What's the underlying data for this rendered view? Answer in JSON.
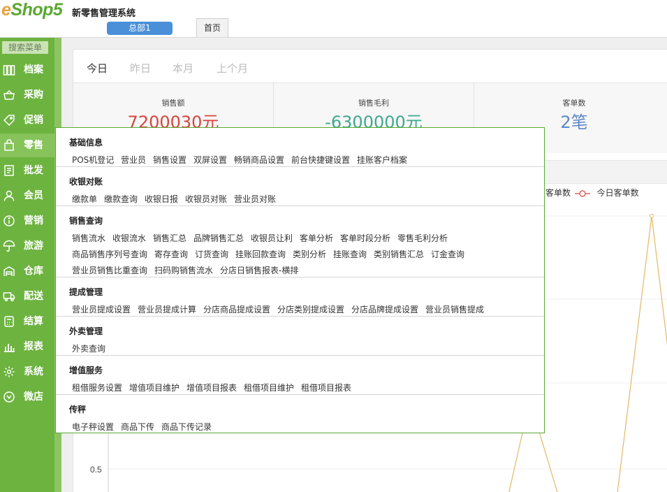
{
  "header": {
    "logo_e": "e",
    "logo_rest": "Shop5",
    "system_title": "新零售管理系统",
    "branch": "总部1",
    "home_tab": "首页"
  },
  "sidebar": {
    "search_label": "搜索菜单",
    "items": [
      {
        "label": "档案",
        "icon": "archive-icon"
      },
      {
        "label": "采购",
        "icon": "basket-icon"
      },
      {
        "label": "促销",
        "icon": "tag-icon"
      },
      {
        "label": "零售",
        "icon": "shopping-bag-icon"
      },
      {
        "label": "批发",
        "icon": "receipt-icon"
      },
      {
        "label": "会员",
        "icon": "person-icon"
      },
      {
        "label": "营销",
        "icon": "info-icon"
      },
      {
        "label": "旅游",
        "icon": "umbrella-icon"
      },
      {
        "label": "仓库",
        "icon": "warehouse-icon"
      },
      {
        "label": "配送",
        "icon": "truck-icon"
      },
      {
        "label": "结算",
        "icon": "calculator-icon"
      },
      {
        "label": "报表",
        "icon": "bar-chart-icon"
      },
      {
        "label": "系统",
        "icon": "gear-icon"
      },
      {
        "label": "微店",
        "icon": "shop-icon"
      }
    ]
  },
  "dashboard": {
    "period_tabs": [
      "今日",
      "昨日",
      "本月",
      "上个月"
    ],
    "stats": [
      {
        "title": "销售额",
        "value": "7200030元",
        "color": "#d9453f"
      },
      {
        "title": "销售毛利",
        "value": "-6300000元",
        "color": "#3fa98f"
      },
      {
        "title": "客单数",
        "value": "2笔",
        "color": "#5b87c9"
      }
    ],
    "legend": {
      "prev_label": "客单数",
      "today_label": "今日客单数"
    },
    "y_tick": "0.5"
  },
  "menu": {
    "sections": [
      {
        "title": "基础信息",
        "rows": [
          [
            "POS机登记",
            "营业员",
            "销售设置",
            "双屏设置",
            "畅销商品设置",
            "前台快捷键设置",
            "挂账客户档案"
          ]
        ]
      },
      {
        "title": "收银对账",
        "rows": [
          [
            "缴款单",
            "缴款查询",
            "收银日报",
            "收银员对账",
            "营业员对账"
          ]
        ]
      },
      {
        "title": "销售查询",
        "rows": [
          [
            "销售流水",
            "收银流水",
            "销售汇总",
            "品牌销售汇总",
            "收银员让利",
            "客单分析",
            "客单时段分析",
            "零售毛利分析"
          ],
          [
            "商品销售序列号查询",
            "寄存查询",
            "订货查询",
            "挂账回款查询",
            "类别分析",
            "挂账查询",
            "类别销售汇总",
            "订金查询"
          ],
          [
            "营业员销售比重查询",
            "扫码购销售流水",
            "分店日销售报表-横排"
          ]
        ]
      },
      {
        "title": "提成管理",
        "rows": [
          [
            "营业员提成设置",
            "营业员提成计算",
            "分店商品提成设置",
            "分店类别提成设置",
            "分店品牌提成设置",
            "营业员销售提成"
          ]
        ]
      },
      {
        "title": "外卖管理",
        "rows": [
          [
            "外卖查询"
          ]
        ]
      },
      {
        "title": "增值服务",
        "rows": [
          [
            "租借服务设置",
            "增值项目维护",
            "增值项目报表",
            "租借项目维护",
            "租借项目报表"
          ]
        ]
      },
      {
        "title": "传秤",
        "rows": [
          [
            "电子秤设置",
            "商品下传",
            "商品下传记录"
          ]
        ]
      }
    ]
  },
  "colors": {
    "sidebar": "#6db33f",
    "accent_green": "#5aa832",
    "chart_line": "#e3b766"
  }
}
